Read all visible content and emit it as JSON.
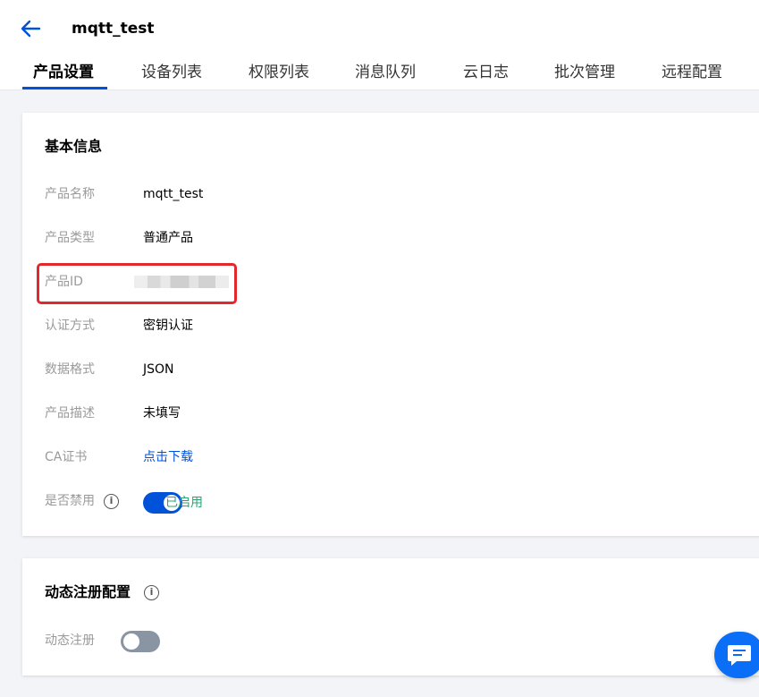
{
  "header": {
    "title": "mqtt_test",
    "back_icon": "arrow-left-icon"
  },
  "tabs": [
    {
      "label": "产品设置",
      "active": true
    },
    {
      "label": "设备列表",
      "active": false
    },
    {
      "label": "权限列表",
      "active": false
    },
    {
      "label": "消息队列",
      "active": false
    },
    {
      "label": "云日志",
      "active": false
    },
    {
      "label": "批次管理",
      "active": false
    },
    {
      "label": "远程配置",
      "active": false
    }
  ],
  "basic_info": {
    "title": "基本信息",
    "rows": [
      {
        "label": "产品名称",
        "value": "mqtt_test"
      },
      {
        "label": "产品类型",
        "value": "普通产品"
      },
      {
        "label": "产品ID",
        "value": ""
      },
      {
        "label": "认证方式",
        "value": "密钥认证"
      },
      {
        "label": "数据格式",
        "value": "JSON"
      },
      {
        "label": "产品描述",
        "value": "未填写"
      },
      {
        "label": "CA证书",
        "value": "点击下载"
      },
      {
        "label": "是否禁用",
        "value": "已启用"
      }
    ]
  },
  "dynamic_reg": {
    "title": "动态注册配置",
    "label": "动态注册"
  },
  "colors": {
    "brand": "#0052d9",
    "enabled_text": "#2ba471",
    "highlight": "#e5272b",
    "toggle_off": "#8a95a3"
  }
}
